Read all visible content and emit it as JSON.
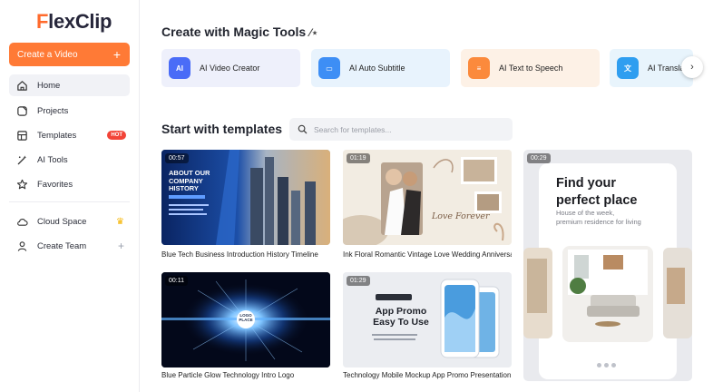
{
  "sidebar": {
    "logo": {
      "f": "F",
      "rest": "lexClip"
    },
    "create_button": "Create a Video",
    "nav": [
      {
        "label": "Home",
        "icon": "home-icon"
      },
      {
        "label": "Projects",
        "icon": "folder-icon"
      },
      {
        "label": "Templates",
        "icon": "templates-icon",
        "badge": "HOT"
      },
      {
        "label": "AI Tools",
        "icon": "magic-wand-icon"
      },
      {
        "label": "Favorites",
        "icon": "star-icon"
      }
    ],
    "cloud": {
      "label": "Cloud Space",
      "icon": "cloud-icon"
    },
    "team": {
      "label": "Create Team",
      "icon": "user-icon"
    }
  },
  "magic": {
    "title": "Create with Magic Tools",
    "tools": [
      {
        "label": "AI Video Creator",
        "bg": "#eef0fb",
        "icon_bg": "#4a6cf7",
        "icon_text": "AI"
      },
      {
        "label": "AI Auto Subtitle",
        "bg": "#e8f3fd",
        "icon_bg": "#3d8ef5",
        "icon_text": "▭"
      },
      {
        "label": "AI Text to Speech",
        "bg": "#fdf1e6",
        "icon_bg": "#fb8a3c",
        "icon_text": "≡"
      },
      {
        "label": "AI Translator",
        "bg": "#e8f4fc",
        "icon_bg": "#2f9ef0",
        "icon_text": "文"
      }
    ]
  },
  "templates": {
    "title": "Start with templates",
    "search_placeholder": "Search for templates...",
    "cards": [
      {
        "duration": "00:57",
        "caption": "Blue Tech Business Introduction History Timeline",
        "overlay": [
          "ABOUT OUR",
          "COMPANY",
          "HISTORY"
        ]
      },
      {
        "duration": "01:19",
        "caption": "Ink Floral Romantic Vintage Love Wedding Anniversary",
        "overlay": [
          "Love Forever"
        ]
      },
      {
        "duration": "00:11",
        "caption": "Blue Particle Glow Technology Intro Logo",
        "overlay": [
          "LOGO",
          "PLACE"
        ]
      },
      {
        "duration": "01:29",
        "caption": "Technology Mobile Mockup App Promo Presentation",
        "overlay": [
          "App Promo",
          "Easy To Use"
        ]
      }
    ],
    "tall": {
      "duration": "00:29",
      "headline": [
        "Find your",
        "perfect place"
      ],
      "sub": [
        "House of the week,",
        "premium residence for living"
      ]
    }
  }
}
